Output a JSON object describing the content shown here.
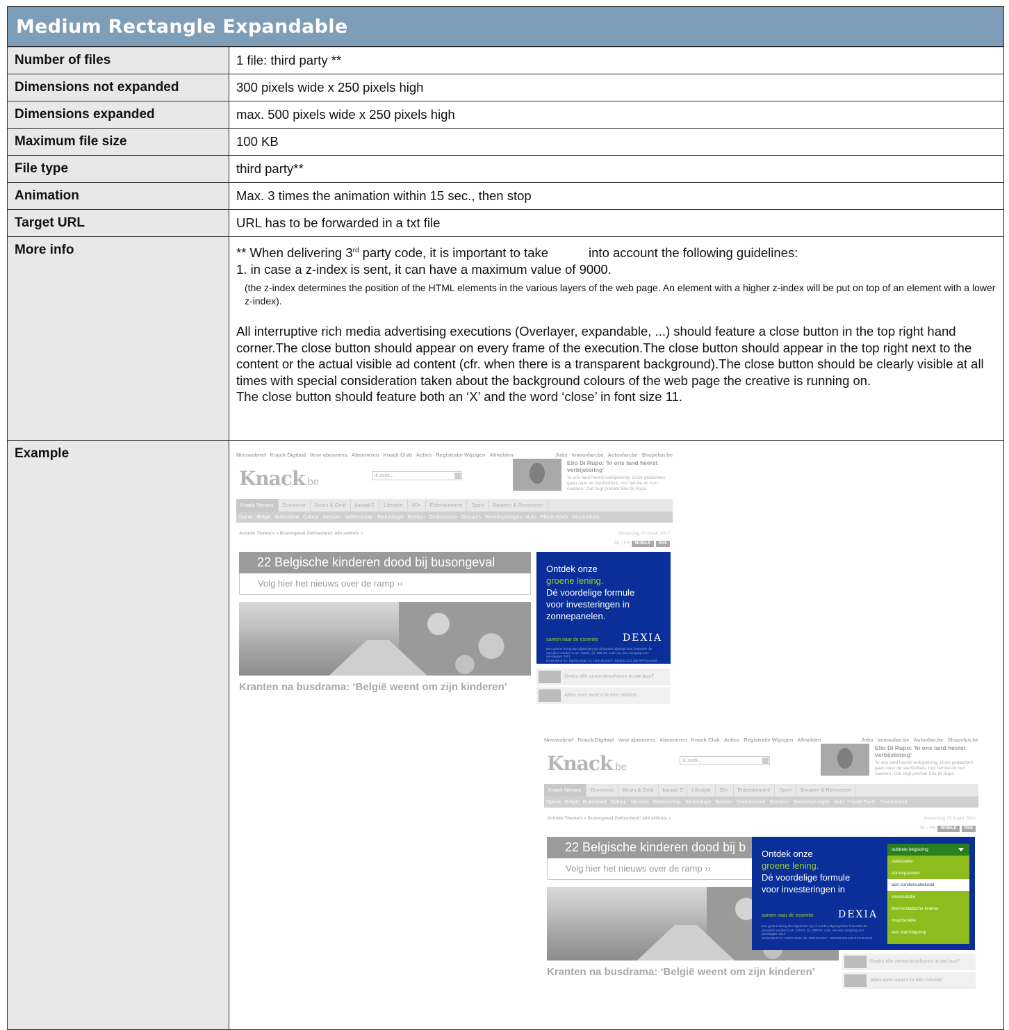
{
  "title": "Medium Rectangle Expandable",
  "rows": {
    "files": {
      "label": "Number of files",
      "value": "1 file: third party **"
    },
    "dims_not_expanded": {
      "label": "Dimensions not expanded",
      "value": "300 pixels wide x 250 pixels high"
    },
    "dims_expanded": {
      "label": "Dimensions expanded",
      "value": "max. 500 pixels wide x 250 pixels high"
    },
    "max_size": {
      "label": "Maximum file size",
      "value": "100 KB"
    },
    "file_type": {
      "label": "File type",
      "value": "third party**"
    },
    "animation": {
      "label": "Animation",
      "value": "Max. 3 times the animation within 15 sec., then stop"
    },
    "target_url": {
      "label": "Target URL",
      "value": "URL has to be forwarded in a txt file"
    },
    "more_info": {
      "label": "More info",
      "line1_a": "** When delivering 3",
      "line1_sup": "rd",
      "line1_b": " party code, it is important to take",
      "line1_c": "into account the following guidelines:",
      "line2": "1. in case a z-index is sent, it can have a maximum value of 9000.",
      "small": "(the z-index determines the position of the HTML elements in the various layers of the web page. An element with a higher z-index will be put on top of an element with a lower z-index).",
      "para": "All interruptive rich media advertising executions (Overlayer, expandable, ...) should feature a close button in the top right hand corner.The close button should appear on every frame of the execution.The close button should appear in the top right next to the content or the actual visible ad content (cfr. when there is a transparent background).The close button should be clearly visible at all times with special consideration taken about the background colours of the web page the creative is running on.",
      "last": "The close button should feature both an ‘X’ and the word ‘close’ in font size 11."
    },
    "example": {
      "label": "Example"
    }
  },
  "mock": {
    "topnav": [
      "Nieuwsbrief",
      "Knack Digitaal",
      "Voor abonnees",
      "Abonneren",
      "Knack Club",
      "Acties",
      "Registratie Wijzigen",
      "Afmelden"
    ],
    "topnav_right": [
      "Jobs",
      "Immovlan.be",
      "Autovlan.be",
      "Shopvlan.be"
    ],
    "logo": "Knack",
    "logo_suffix": ".be",
    "search_placeholder": "ik zoek...",
    "news_title": "Elio Di Rupo: 'In ons land heerst verbijstering'",
    "news_body": "'In ons land heerst verbijstering. Onze gedachten gaan naar de slachtoffers, hun familie en hun naasten.' Dat zegt premier Elio Di Rupo",
    "mainnav": [
      "Knack Nieuws",
      "Economie",
      "Beurs & Geld",
      "kanaal Z",
      "Lifestyle",
      "50+",
      "Entertainment",
      "Sport",
      "Bouwen & Renoveren"
    ],
    "subnav": [
      "Opinie",
      "België",
      "Buitenland",
      "Cultuur",
      "Mensen",
      "Wetenschap",
      "Technologie",
      "Boeken",
      "Ondertussen",
      "Dossiers",
      "Beeldreportages",
      "Auto",
      "Planet Earth",
      "Gezondheid"
    ],
    "breadcrumb": "Actuele Thema's » Busongeval Zwitserland: alle artikels »",
    "date": "donderdag 15 maart 2012",
    "lang": "NL / FR",
    "mobile": "MOBILE",
    "rss": "RSS",
    "headline": "22 Belgische kinderen dood bij busongeval",
    "headline_cut": "22 Belgische kinderen dood bij b",
    "subline": "Volg hier het nieuws over de ramp  ››",
    "kranten": "Kranten na busdrama: ‘België weent om zijn kinderen’",
    "side1": "Gratis alle zomerbrochures in uw bus?",
    "side2": "Alles over auto's in één rubriek"
  },
  "ad": {
    "line1": "Ontdek onze",
    "line2": "groene lening.",
    "line3": "Dé voordelige formule",
    "line4": "voor investeringen in",
    "line5": "zonnepanelen.",
    "tagline": "samen naar de essentie",
    "brand": "DEXIA",
    "fine1": "Een groene lening kan afgesloten zijn of worden afgelegd door financiële die aanvullen worden in art. 145/24, §1, WIB 92, code van een overgang voor aanslagjaar 2013.",
    "fine2": "Dexia Bank NV, Pachecolaan 44, 1000 Brussel – BE0403.201.185 RPR Brussel",
    "options": [
      "dubbele beglazing",
      "dakisolatie",
      "zonnepanelen",
      "een condensatieketel",
      "vloerisolatie",
      "thermostatische kranen",
      "muurisolatie",
      "een warmtepomp"
    ]
  }
}
